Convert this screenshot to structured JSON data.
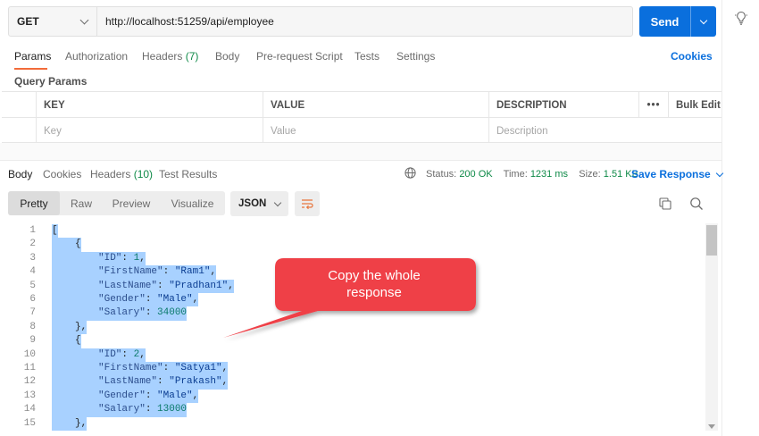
{
  "request": {
    "method": "GET",
    "url": "http://localhost:51259/api/employee",
    "send_label": "Send"
  },
  "request_tabs": {
    "params": "Params",
    "authorization": "Authorization",
    "headers": "Headers",
    "headers_count": "(7)",
    "body": "Body",
    "prerequest": "Pre-request Script",
    "tests": "Tests",
    "settings": "Settings",
    "cookies": "Cookies"
  },
  "query_params": {
    "title": "Query Params",
    "columns": {
      "key": "KEY",
      "value": "VALUE",
      "description": "DESCRIPTION"
    },
    "more_menu": "•••",
    "bulk_edit": "Bulk Edit",
    "placeholders": {
      "key": "Key",
      "value": "Value",
      "description": "Description"
    }
  },
  "response_tabs": {
    "body": "Body",
    "cookies": "Cookies",
    "headers": "Headers",
    "headers_count": "(10)",
    "test_results": "Test Results"
  },
  "response_meta": {
    "status_label": "Status:",
    "status_value": "200 OK",
    "time_label": "Time:",
    "time_value": "1231 ms",
    "size_label": "Size:",
    "size_value": "1.51 KB",
    "save_response": "Save Response"
  },
  "view_modes": {
    "pretty": "Pretty",
    "raw": "Raw",
    "preview": "Preview",
    "visualize": "Visualize",
    "format": "JSON"
  },
  "code_lines": [
    {
      "n": "1",
      "indent": 0,
      "text": "["
    },
    {
      "n": "2",
      "indent": 1,
      "text": "{"
    },
    {
      "n": "3",
      "indent": 2,
      "key": "\"ID\"",
      "sep": ": ",
      "val": "1",
      "vtype": "num",
      "tail": ","
    },
    {
      "n": "4",
      "indent": 2,
      "key": "\"FirstName\"",
      "sep": ": ",
      "val": "\"Ram1\"",
      "vtype": "str",
      "tail": ","
    },
    {
      "n": "5",
      "indent": 2,
      "key": "\"LastName\"",
      "sep": ": ",
      "val": "\"Pradhan1\"",
      "vtype": "str",
      "tail": ","
    },
    {
      "n": "6",
      "indent": 2,
      "key": "\"Gender\"",
      "sep": ": ",
      "val": "\"Male\"",
      "vtype": "str",
      "tail": ","
    },
    {
      "n": "7",
      "indent": 2,
      "key": "\"Salary\"",
      "sep": ": ",
      "val": "34000",
      "vtype": "num",
      "tail": ""
    },
    {
      "n": "8",
      "indent": 1,
      "text": "},"
    },
    {
      "n": "9",
      "indent": 1,
      "text": "{"
    },
    {
      "n": "10",
      "indent": 2,
      "key": "\"ID\"",
      "sep": ": ",
      "val": "2",
      "vtype": "num",
      "tail": ","
    },
    {
      "n": "11",
      "indent": 2,
      "key": "\"FirstName\"",
      "sep": ": ",
      "val": "\"Satya1\"",
      "vtype": "str",
      "tail": ","
    },
    {
      "n": "12",
      "indent": 2,
      "key": "\"LastName\"",
      "sep": ": ",
      "val": "\"Prakash\"",
      "vtype": "str",
      "tail": ","
    },
    {
      "n": "13",
      "indent": 2,
      "key": "\"Gender\"",
      "sep": ": ",
      "val": "\"Male\"",
      "vtype": "str",
      "tail": ","
    },
    {
      "n": "14",
      "indent": 2,
      "key": "\"Salary\"",
      "sep": ": ",
      "val": "13000",
      "vtype": "num",
      "tail": ""
    },
    {
      "n": "15",
      "indent": 1,
      "text": "},"
    }
  ],
  "annotation": {
    "text_line1": "Copy the whole",
    "text_line2": "response",
    "color": "#ef3f47"
  },
  "icons": {
    "bulb": "lightbulb-icon",
    "globe": "globe-icon",
    "wrap": "wrap-lines-icon",
    "copy": "copy-icon",
    "search": "search-icon"
  },
  "colors": {
    "accent_blue": "#0a6fdd",
    "tab_orange": "#f26b3a",
    "status_green": "#0f8a48",
    "selection": "#a8d1ff"
  }
}
